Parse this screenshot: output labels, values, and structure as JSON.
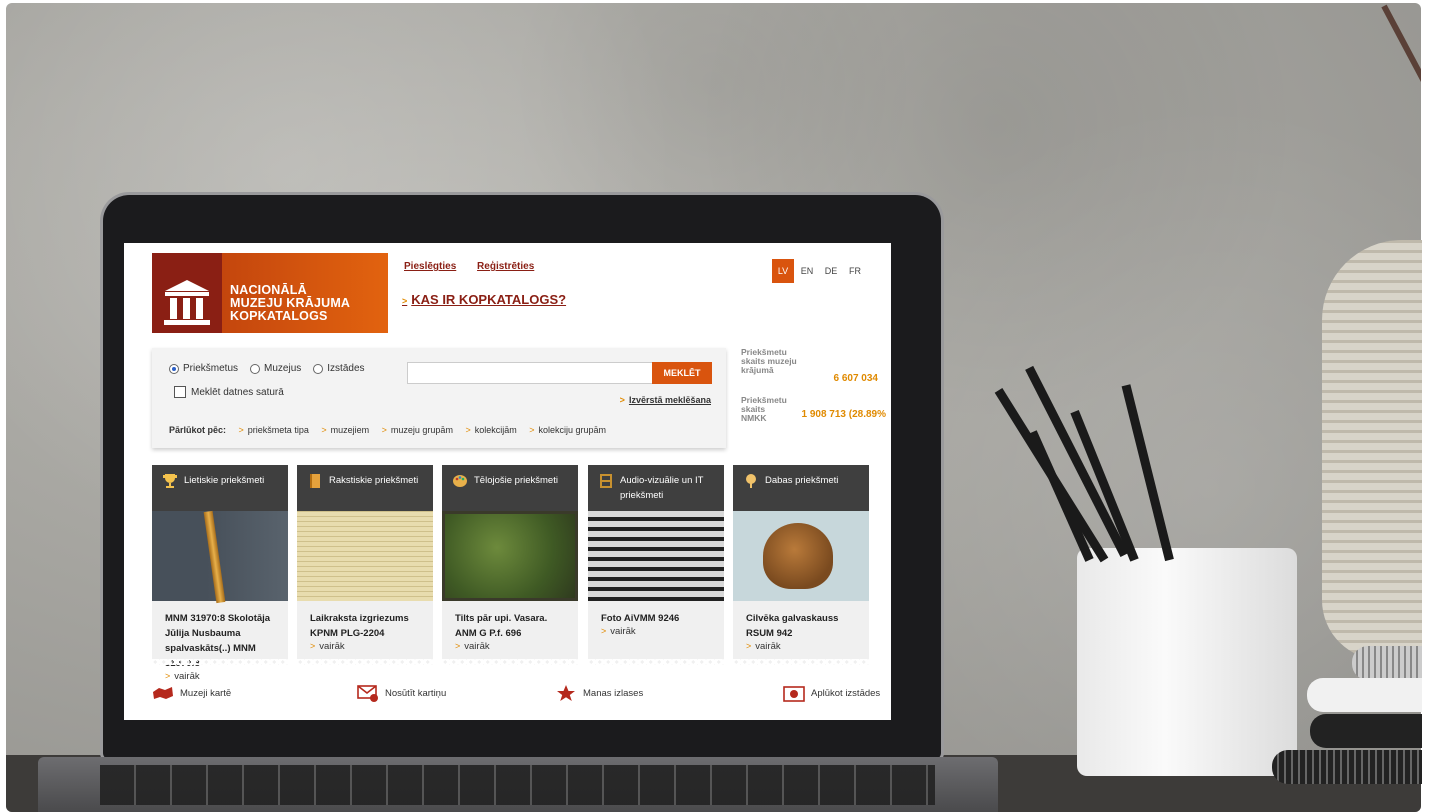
{
  "site": {
    "logo_text_1": "NACIONĀLĀ",
    "logo_text_2": "MUZEJU KRĀJUMA",
    "logo_text_3": "KOPKATALOGS",
    "login": "Pieslēgties",
    "register": "Reģistrēties",
    "about": "KAS IR KOPKATALOGS?",
    "languages": [
      "LV",
      "EN",
      "DE",
      "FR"
    ],
    "active_language": "LV",
    "colors": {
      "accent": "#d9540e",
      "brand_dark": "#8a1f14",
      "number": "#e08a00"
    }
  },
  "search": {
    "radios": [
      "Priekšmetus",
      "Muzejus",
      "Izstādes"
    ],
    "selected": "Priekšmetus",
    "checkbox_label": "Meklēt datnes saturā",
    "input_value": "",
    "button": "MEKLĒT",
    "advanced": "Izvērstā meklēšana",
    "browse_label": "Pārlūkot pēc:",
    "browse_links": [
      "priekšmeta tipa",
      "muzejiem",
      "muzeju grupām",
      "kolekcijām",
      "kolekciju grupām"
    ]
  },
  "stats": {
    "label1": "Priekšmetu skaits muzeju krājumā",
    "value1": "6 607 034",
    "label2": "Priekšmetu skaits NMKK",
    "value2": "1 908 713 (28.89%"
  },
  "categories": [
    {
      "title": "Lietiskie priekšmeti",
      "icon": "trophy-icon",
      "caption": "MNM 31970:8 Skolotāja Jūlija Nusbauma spalvaskāts(..) MNM 31970:8",
      "more": "vairāk"
    },
    {
      "title": "Rakstiskie priekšmeti",
      "icon": "book-icon",
      "caption": "Laikraksta izgriezums KPNM PLG-2204",
      "more": "vairāk"
    },
    {
      "title": "Tēlojošie priekšmeti",
      "icon": "palette-icon",
      "caption": "Tilts pār upi. Vasara. ANM G P.f. 696",
      "more": "vairāk"
    },
    {
      "title": "Audio-vizuālie un IT priekšmeti",
      "icon": "film-icon",
      "caption": "Foto AiVMM 9246",
      "more": "vairāk"
    },
    {
      "title": "Dabas priekšmeti",
      "icon": "tree-icon",
      "caption": "Cilvēka galvaskauss RSUM 942",
      "more": "vairāk"
    }
  ],
  "footer": {
    "map": "Muzeji kartē",
    "postcard": "Nosūtīt kartiņu",
    "selections": "Manas izlases",
    "exhibitions": "Aplūkot izstādes"
  }
}
